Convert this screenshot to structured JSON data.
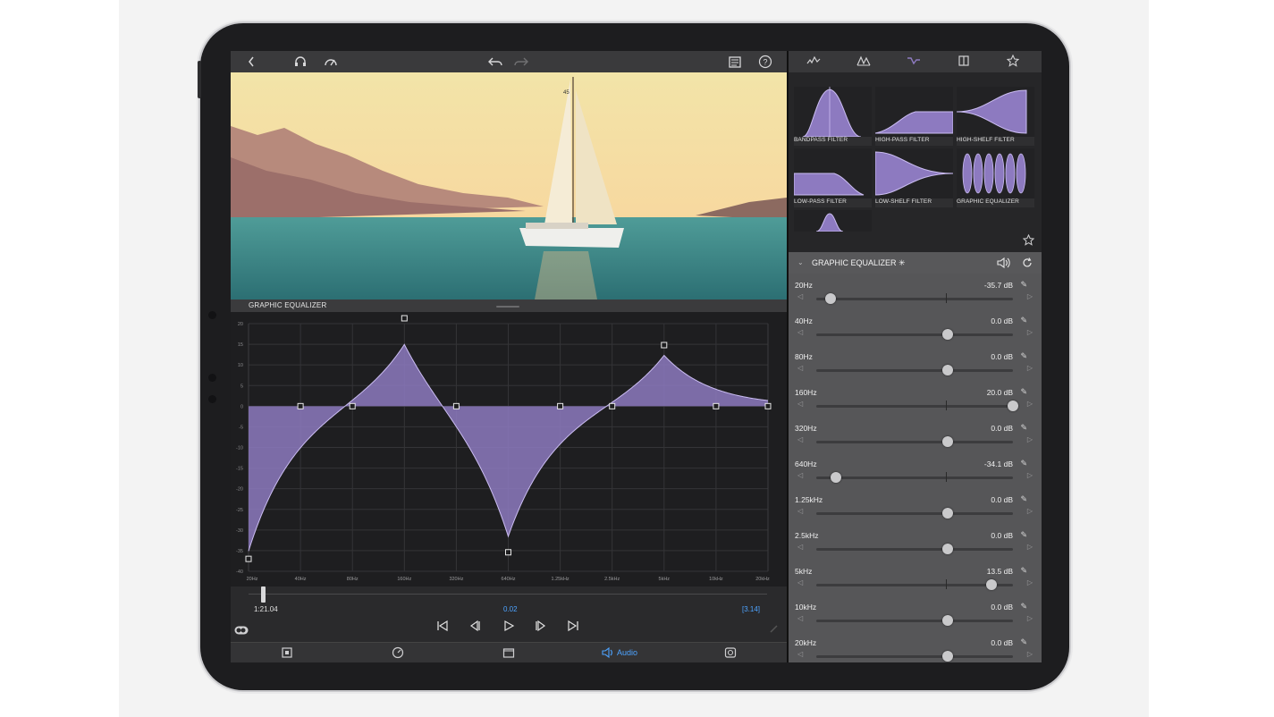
{
  "colors": {
    "accent": "#4da3ff",
    "curve_fill": "#8d7ac0",
    "curve_stroke": "#cbbdf2"
  },
  "left_toolbar": {
    "icons": [
      "back-chevron-icon",
      "headphones-icon",
      "gauge-icon",
      "undo-icon",
      "redo-icon",
      "clipboard-icon",
      "help-icon"
    ]
  },
  "eq_section": {
    "title": "GRAPHIC EQUALIZER"
  },
  "graph": {
    "y_ticks": [
      "20",
      "15",
      "10",
      "5",
      "0",
      "-5",
      "-10",
      "-15",
      "-20",
      "-25",
      "-30",
      "-35",
      "-40"
    ],
    "x_ticks": [
      "20Hz",
      "40Hz",
      "80Hz",
      "160Hz",
      "320Hz",
      "640Hz",
      "1.25kHz",
      "2.5kHz",
      "5kHz",
      "10kHz",
      "20kHz"
    ],
    "ylim": [
      -40,
      20
    ]
  },
  "transport": {
    "timecode": "1:21.04",
    "center_value": "0.02",
    "right_value": "[3.14]",
    "buttons": [
      "skip-to-start-icon",
      "step-back-icon",
      "play-icon",
      "step-forward-icon",
      "skip-to-end-icon"
    ]
  },
  "bottom_bar": {
    "audio_label": "Audio"
  },
  "right_panel": {
    "presets": [
      {
        "label": "BANDPASS FILTER"
      },
      {
        "label": "HIGH-PASS FILTER"
      },
      {
        "label": "HIGH-SHELF FILTER"
      },
      {
        "label": "LOW-PASS FILTER"
      },
      {
        "label": "LOW-SHELF FILTER"
      },
      {
        "label": "GRAPHIC EQUALIZER"
      }
    ],
    "eq_panel_title": "GRAPHIC EQUALIZER ✳",
    "db_range": [
      -40,
      20
    ],
    "bands": [
      {
        "freq": "20Hz",
        "db": "-35.7 dB",
        "value": -35.7
      },
      {
        "freq": "40Hz",
        "db": "0.0 dB",
        "value": 0.0
      },
      {
        "freq": "80Hz",
        "db": "0.0 dB",
        "value": 0.0
      },
      {
        "freq": "160Hz",
        "db": "20.0 dB",
        "value": 20.0
      },
      {
        "freq": "320Hz",
        "db": "0.0 dB",
        "value": 0.0
      },
      {
        "freq": "640Hz",
        "db": "-34.1 dB",
        "value": -34.1
      },
      {
        "freq": "1.25kHz",
        "db": "0.0 dB",
        "value": 0.0
      },
      {
        "freq": "2.5kHz",
        "db": "0.0 dB",
        "value": 0.0
      },
      {
        "freq": "5kHz",
        "db": "13.5 dB",
        "value": 13.5
      },
      {
        "freq": "10kHz",
        "db": "0.0 dB",
        "value": 0.0
      },
      {
        "freq": "20kHz",
        "db": "0.0 dB",
        "value": 0.0
      }
    ]
  }
}
